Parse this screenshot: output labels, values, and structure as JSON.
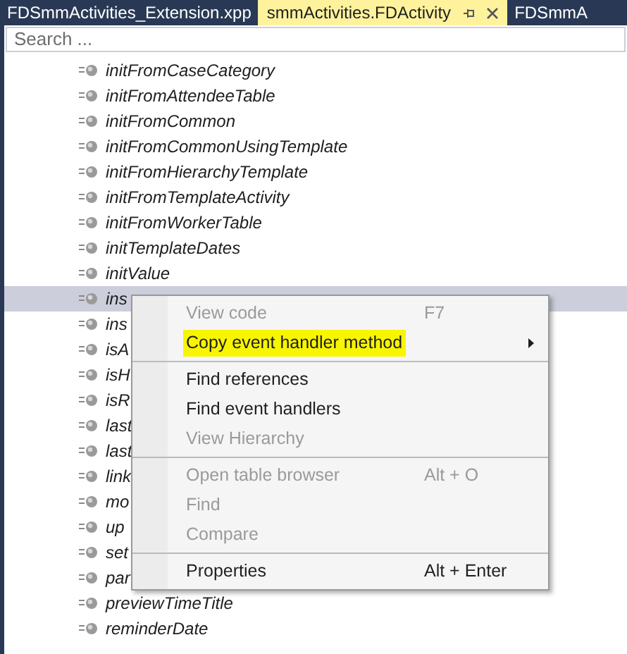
{
  "tabs": [
    {
      "label": "FDSmmActivities_Extension.xpp",
      "selected": false
    },
    {
      "label": "smmActivities.FDActivity",
      "selected": true
    },
    {
      "label": "FDSmmA",
      "selected": false
    }
  ],
  "search": {
    "placeholder": "Search ..."
  },
  "tree": {
    "items": [
      {
        "label": "initFromCaseCategory",
        "selected": false
      },
      {
        "label": "initFromAttendeeTable",
        "selected": false
      },
      {
        "label": "initFromCommon",
        "selected": false
      },
      {
        "label": "initFromCommonUsingTemplate",
        "selected": false
      },
      {
        "label": "initFromHierarchyTemplate",
        "selected": false
      },
      {
        "label": "initFromTemplateActivity",
        "selected": false
      },
      {
        "label": "initFromWorkerTable",
        "selected": false
      },
      {
        "label": "initTemplateDates",
        "selected": false
      },
      {
        "label": "initValue",
        "selected": false
      },
      {
        "label": "ins",
        "selected": true
      },
      {
        "label": "ins",
        "selected": false
      },
      {
        "label": "isA",
        "selected": false
      },
      {
        "label": "isH",
        "selected": false
      },
      {
        "label": "isR",
        "selected": false
      },
      {
        "label": "last",
        "selected": false
      },
      {
        "label": "last",
        "selected": false
      },
      {
        "label": "link",
        "selected": false
      },
      {
        "label": "mo",
        "selected": false
      },
      {
        "label": "up",
        "selected": false
      },
      {
        "label": "set",
        "selected": false
      },
      {
        "label": "par",
        "selected": false
      },
      {
        "label": "previewTimeTitle",
        "selected": false
      },
      {
        "label": "reminderDate",
        "selected": false
      }
    ]
  },
  "context_menu": {
    "groups": [
      [
        {
          "label": "View code",
          "shortcut": "F7",
          "disabled": true,
          "highlighted": false,
          "submenu": false
        },
        {
          "label": "Copy event handler method",
          "disabled": false,
          "highlighted": true,
          "submenu": true
        }
      ],
      [
        {
          "label": "Find references",
          "disabled": false,
          "highlighted": false,
          "submenu": false
        },
        {
          "label": "Find event handlers",
          "disabled": false,
          "highlighted": false,
          "submenu": false
        },
        {
          "label": "View Hierarchy",
          "disabled": true,
          "highlighted": false,
          "submenu": false
        }
      ],
      [
        {
          "label": "Open table browser",
          "shortcut": "Alt + O",
          "disabled": true,
          "highlighted": false,
          "submenu": false
        },
        {
          "label": "Find",
          "disabled": true,
          "highlighted": false,
          "submenu": false
        },
        {
          "label": "Compare",
          "disabled": true,
          "highlighted": false,
          "submenu": false
        }
      ],
      [
        {
          "label": "Properties",
          "shortcut": "Alt + Enter",
          "disabled": false,
          "highlighted": false,
          "submenu": false
        }
      ]
    ]
  }
}
